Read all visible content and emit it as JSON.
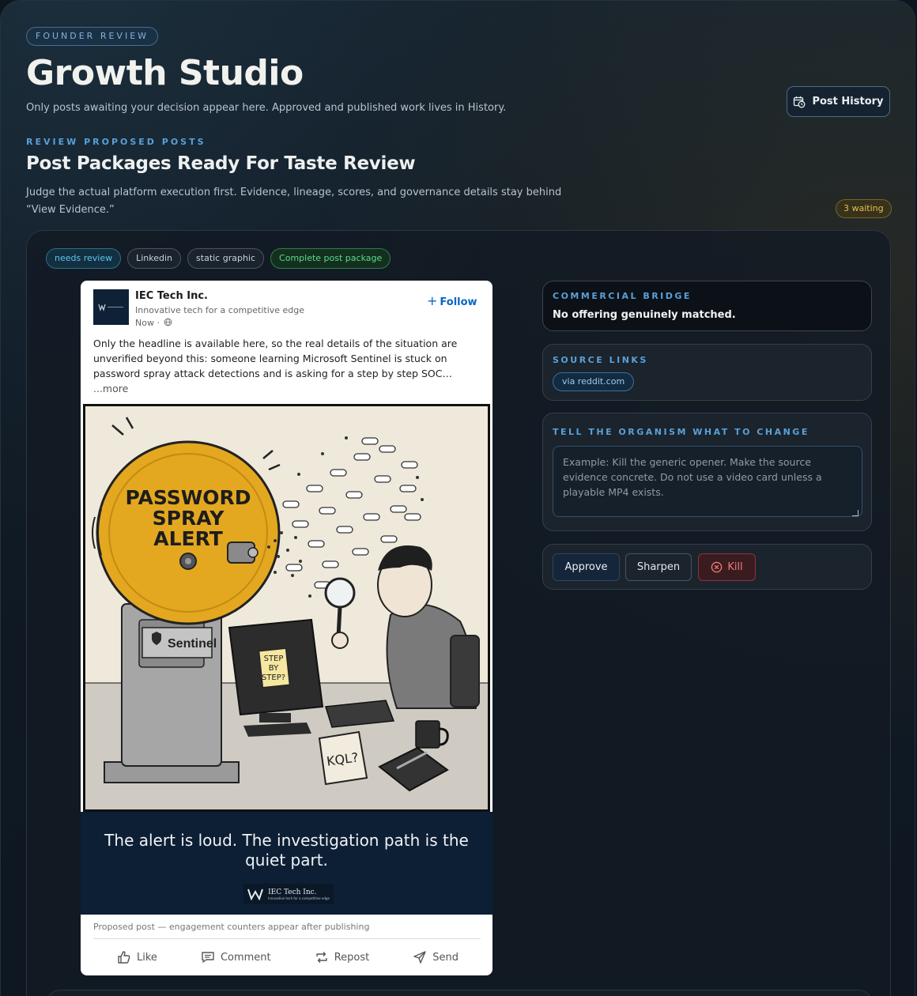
{
  "header": {
    "kicker": "FOUNDER REVIEW",
    "title": "Growth Studio",
    "subtitle": "Only posts awaiting your decision appear here. Approved and published work lives in History.",
    "history_button": "Post History"
  },
  "section": {
    "kicker": "REVIEW PROPOSED POSTS",
    "title": "Post Packages Ready For Taste Review",
    "description": "Judge the actual platform execution first. Evidence, lineage, scores, and governance details stay behind “View Evidence.”",
    "waiting_badge": "3 waiting"
  },
  "chips": [
    "needs review",
    "Linkedin",
    "static graphic",
    "Complete post package"
  ],
  "post": {
    "company": "IEC Tech Inc.",
    "tagline": "Innovative tech for a competitive edge",
    "time": "Now ·",
    "follow": "Follow",
    "text": "Only the headline is available here, so the real details of the situation are unverified beyond this: someone learning Microsoft Sentinel is stuck on password spray attack detections and is asking for a step by step SOC…",
    "more": "...more",
    "image": {
      "bell_text": [
        "PASSWORD",
        "SPRAY",
        "ALERT"
      ],
      "base_label": "Sentinel",
      "note_text": [
        "STEP",
        "BY",
        "STEP?"
      ],
      "calendar_text": "KQL?"
    },
    "caption": "The alert is loud. The investigation path is the quiet part.",
    "brand_name": "IEC Tech Inc.",
    "brand_tag": "Innovative tech for a competitive edge",
    "proposed_note": "Proposed post — engagement counters appear after publishing",
    "actions": [
      "Like",
      "Comment",
      "Repost",
      "Send"
    ]
  },
  "panels": {
    "bridge_kicker": "COMMERCIAL BRIDGE",
    "bridge_text": "No offering genuinely matched.",
    "sources_kicker": "SOURCE LINKS",
    "source_chip": "via reddit.com",
    "tell_kicker": "TELL THE ORGANISM WHAT TO CHANGE",
    "tell_placeholder": "Example: Kill the generic opener. Make the source evidence concrete. Do not use a video card unless a playable MP4 exists.",
    "approve": "Approve",
    "sharpen": "Sharpen",
    "kill": "Kill"
  },
  "colors": {
    "accent_blue": "#5aa0d8",
    "linkedin_blue": "#0a66c2",
    "waiting_gold": "#e8c04a",
    "success_green": "#5fd88a",
    "kill_red": "#f07a7a",
    "bell_yellow": "#e3a820"
  }
}
